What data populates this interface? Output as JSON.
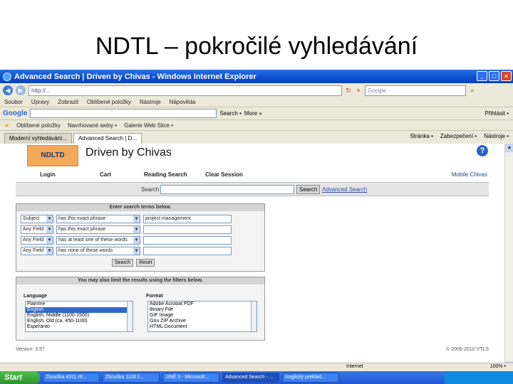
{
  "slide": {
    "title": "NDTL – pokročilé vyhledávání"
  },
  "window": {
    "title": "Advanced Search | Driven by Chivas - Windows Internet Explorer"
  },
  "addressbar": {
    "url": "http://...",
    "search_placeholder": "Google"
  },
  "menu": [
    "Soubor",
    "Úpravy",
    "Zobrazit",
    "Oblíbené položky",
    "Nástroje",
    "Nápověda"
  ],
  "google_toolbar": {
    "logo": "Google",
    "search_label": "Search •",
    "more_label": "More »",
    "signin_label": "Přihlásit •"
  },
  "favorites": {
    "label": "Oblíbené položky",
    "items": [
      "Navrhované weby •",
      "Galerie Web Slice •"
    ]
  },
  "tabs": [
    {
      "label": "Moderní vyhledávání..."
    },
    {
      "label": "Advanced Search | D..."
    }
  ],
  "tab_tools": {
    "page": "Stránka •",
    "safety": "Zabezpečení •",
    "tools": "Nástroje •"
  },
  "site": {
    "logo": "NDLTD",
    "title": "Driven by Chivas",
    "help": "?",
    "nav": [
      "Login",
      "Cart",
      "Reading Search",
      "Clear Session"
    ],
    "mobile": "Mobile Chivas",
    "search_label": "Search",
    "search_button": "Search",
    "advanced_link": "Advanced Search"
  },
  "search_form": {
    "header": "Enter search terms below.",
    "rows": [
      {
        "field": "Subject",
        "op": "has this exact phrase",
        "term": "project management"
      },
      {
        "field": "Any Field",
        "op": "has this exact phrase",
        "term": ""
      },
      {
        "field": "Any Field",
        "op": "has at least one of these words",
        "term": ""
      },
      {
        "field": "Any Field",
        "op": "has none of these words",
        "term": ""
      }
    ],
    "search_button": "Search",
    "reset_button": "Reset"
  },
  "filters": {
    "header": "You may also limit the results using the filters below.",
    "language_label": "Language",
    "languages": [
      "Flamme",
      "English",
      "English, Middle (1100-1500)",
      "English, Old (ca. 450-1100)",
      "Esperanto"
    ],
    "language_selected": 1,
    "format_label": "Format",
    "formats": [
      "Adobe Acrobat PDF",
      "Binary File",
      "GIF Image",
      "Gnu ZIP Archive",
      "HTML Document"
    ]
  },
  "footer": {
    "version": "Version: 3.57",
    "copyright": "© 2006-2010 VTLS"
  },
  "statusbar": {
    "zone": "Internet",
    "zoom": "100% •"
  },
  "taskbar": {
    "start": "Start",
    "tasks": [
      "Zkouška 4311.rtf...",
      "Zkouška 1100.f...",
      "JINÉ 3 - Microsoft...",
      "Advanced Search - ...",
      "Anglický preklad..."
    ],
    "active_index": 3
  }
}
